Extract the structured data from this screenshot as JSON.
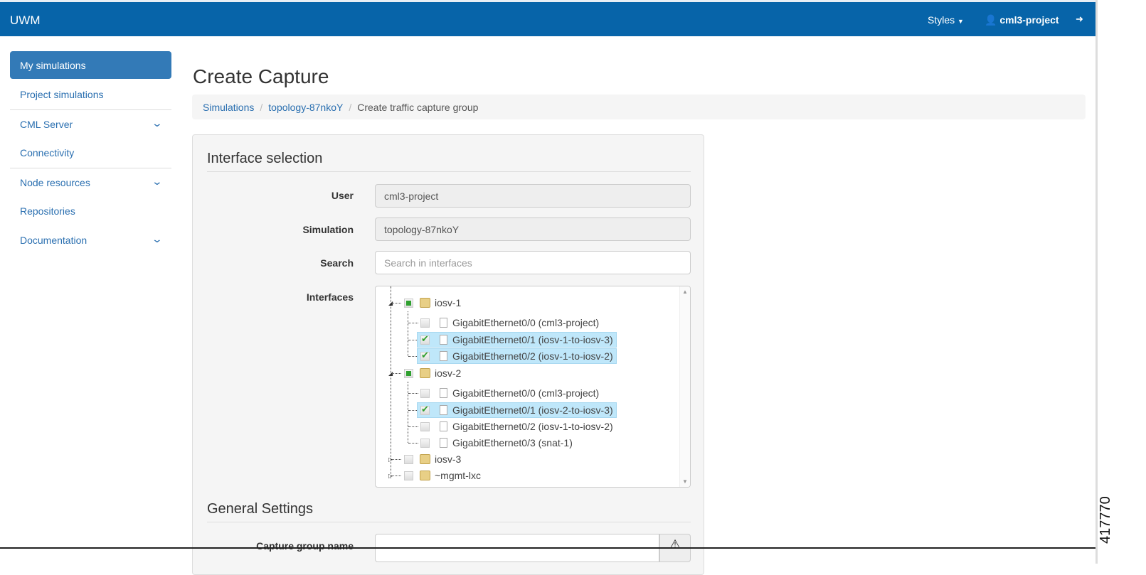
{
  "navbar": {
    "brand": "UWM",
    "styles_label": "Styles",
    "user": "cml3-project"
  },
  "sidebar": {
    "items": [
      {
        "label": "My simulations",
        "active": true
      },
      {
        "label": "Project simulations"
      },
      {
        "label": "CML Server",
        "expandable": true
      },
      {
        "label": "Connectivity"
      },
      {
        "label": "Node resources",
        "expandable": true
      },
      {
        "label": "Repositories"
      },
      {
        "label": "Documentation",
        "expandable": true
      }
    ]
  },
  "page": {
    "title": "Create Capture",
    "breadcrumb": [
      "Simulations",
      "topology-87nkoY",
      "Create traffic capture group"
    ]
  },
  "form": {
    "section1": "Interface selection",
    "user_label": "User",
    "user_value": "cml3-project",
    "simulation_label": "Simulation",
    "simulation_value": "topology-87nkoY",
    "search_label": "Search",
    "search_placeholder": "Search in interfaces",
    "interfaces_label": "Interfaces",
    "tree": [
      {
        "label": "iosv-1",
        "state": "partial",
        "children": [
          {
            "label": "GigabitEthernet0/0 (cml3-project)",
            "checked": false
          },
          {
            "label": "GigabitEthernet0/1 (iosv-1-to-iosv-3)",
            "checked": true
          },
          {
            "label": "GigabitEthernet0/2 (iosv-1-to-iosv-2)",
            "checked": true
          }
        ]
      },
      {
        "label": "iosv-2",
        "state": "partial",
        "children": [
          {
            "label": "GigabitEthernet0/0 (cml3-project)",
            "checked": false
          },
          {
            "label": "GigabitEthernet0/1 (iosv-2-to-iosv-3)",
            "checked": true
          },
          {
            "label": "GigabitEthernet0/2 (iosv-1-to-iosv-2)",
            "checked": false
          },
          {
            "label": "GigabitEthernet0/3 (snat-1)",
            "checked": false
          }
        ]
      },
      {
        "label": "iosv-3",
        "state": "unchecked",
        "children": []
      },
      {
        "label": "~mgmt-lxc",
        "state": "unchecked",
        "children": []
      }
    ],
    "section2": "General Settings",
    "capture_group_label": "Capture group name",
    "capture_group_value": ""
  },
  "figure_id": "417770"
}
